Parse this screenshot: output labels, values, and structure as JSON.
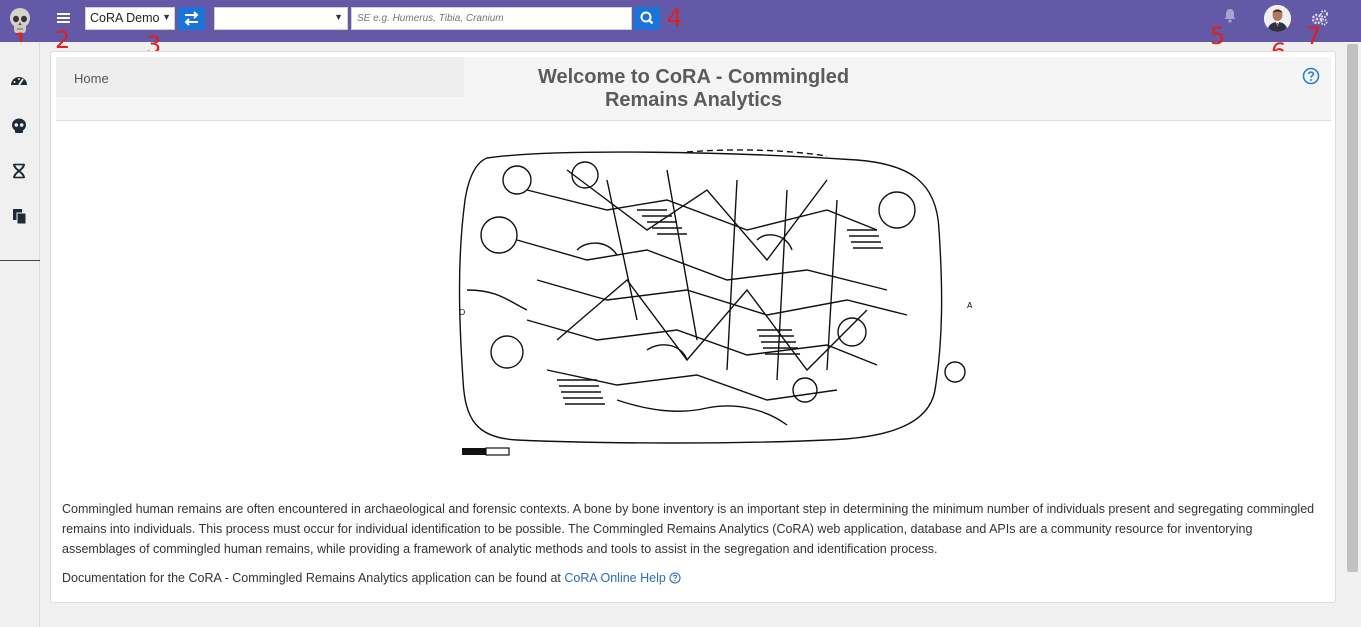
{
  "topbar": {
    "dataset_select": {
      "value": "CoRA Demo"
    },
    "category_select": {
      "value": ""
    },
    "search": {
      "placeholder": "SE e.g. Humerus, Tibia, Cranium"
    }
  },
  "annotations": [
    "1",
    "2",
    "3",
    "4",
    "5",
    "6",
    "7"
  ],
  "sidebar": {
    "items": [
      {
        "icon": "dashboard-icon"
      },
      {
        "icon": "skull-icon"
      },
      {
        "icon": "dna-icon"
      },
      {
        "icon": "copy-icon"
      }
    ]
  },
  "breadcrumb": {
    "home": "Home"
  },
  "page": {
    "title_line1": "Welcome to CoRA - Commingled",
    "title_line2": "Remains Analytics",
    "description": "Commingled human remains are often encountered in archaeological and forensic contexts. A bone by bone inventory is an important step in determining the minimum number of individuals present and segregating commingled remains into individuals. This process must occur for individual identification to be possible. The Commingled Remains Analytics (CoRA) web application, database and APIs are a community resource for inventorying assemblages of commingled human remains, while providing a framework of analytic methods and tools to assist in the segregation and identification process.",
    "doc_text": "Documentation for the CoRA - Commingled Remains Analytics application can be found at",
    "doc_link": "CoRA Online Help",
    "figure": {
      "left_marker": "O",
      "right_marker": "A"
    }
  },
  "colors": {
    "topbar": "#6359a7",
    "button": "#1a73d9",
    "link": "#2a6fb4",
    "annotation": "#e0201d"
  }
}
